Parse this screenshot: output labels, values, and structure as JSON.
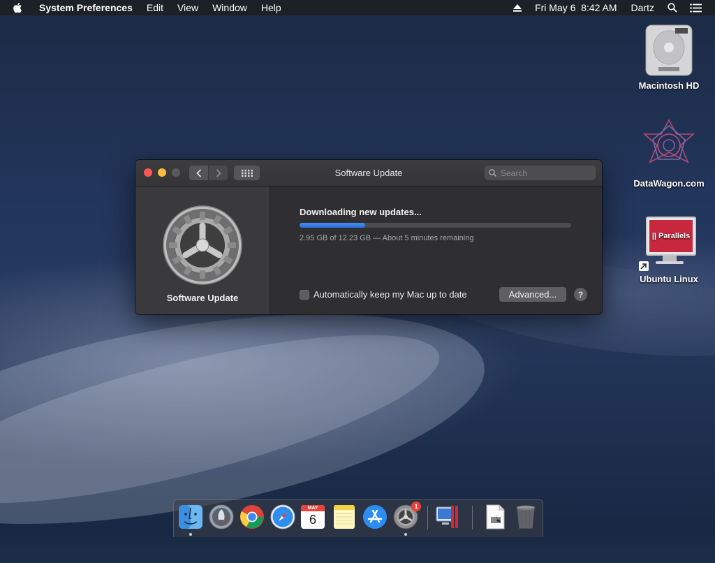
{
  "menubar": {
    "app_name": "System Preferences",
    "menus": [
      "Edit",
      "View",
      "Window",
      "Help"
    ],
    "datetime": "Fri May 6  8:42 AM",
    "user": "Dartz"
  },
  "desktop": {
    "icons": [
      {
        "label": "Macintosh HD",
        "icon": "hard-drive-icon"
      },
      {
        "label": "DataWagon.com",
        "icon": "datawagon-icon"
      },
      {
        "label": "Ubuntu Linux",
        "icon": "parallels-vm-icon",
        "badge_text": "|| Parallels"
      }
    ]
  },
  "window": {
    "title": "Software Update",
    "search_placeholder": "Search",
    "sidebar_label": "Software Update",
    "status_title": "Downloading new updates...",
    "progress_fraction": 0.2412,
    "progress_detail": "2.95 GB of 12.23 GB — About 5 minutes remaining",
    "auto_update_label": "Automatically keep my Mac up to date",
    "auto_update_checked": false,
    "advanced_button": "Advanced...",
    "help_button": "?"
  },
  "dock": {
    "items": [
      {
        "name": "Finder",
        "icon": "finder-icon",
        "running": true
      },
      {
        "name": "Launchpad",
        "icon": "launchpad-icon",
        "running": false
      },
      {
        "name": "Chrome",
        "icon": "chrome-icon",
        "running": false
      },
      {
        "name": "Safari",
        "icon": "safari-icon",
        "running": false
      },
      {
        "name": "Calendar",
        "icon": "calendar-icon",
        "running": false,
        "month": "MAY",
        "day": "6"
      },
      {
        "name": "Notes",
        "icon": "notes-icon",
        "running": false
      },
      {
        "name": "App Store",
        "icon": "app-store-icon",
        "running": false
      },
      {
        "name": "System Preferences",
        "icon": "system-preferences-icon",
        "running": true,
        "badge": "1"
      },
      {
        "name": "Parallels Desktop",
        "icon": "parallels-icon",
        "running": false
      },
      {
        "name": "Document",
        "icon": "document-icon",
        "running": false
      },
      {
        "name": "Trash",
        "icon": "trash-icon",
        "running": false
      }
    ]
  },
  "colors": {
    "accent": "#2a7ae2",
    "close": "#fc5753",
    "minimize": "#fdbc40",
    "badge": "#f23d35"
  }
}
